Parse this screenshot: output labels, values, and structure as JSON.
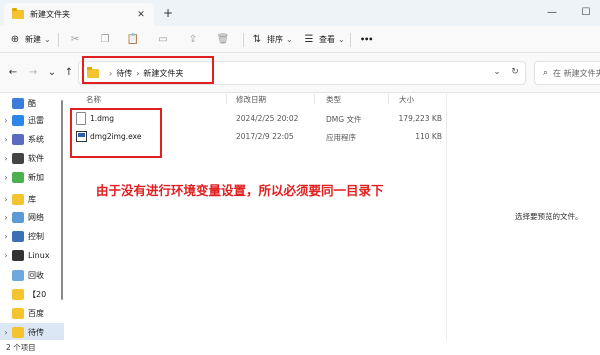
{
  "window": {
    "tab_title": "新建文件夹",
    "tab_close": "✕",
    "new_tab": "+",
    "minimize": "—",
    "maximize": "☐"
  },
  "toolbar": {
    "new_label": "新建",
    "new_chevron": "⌄",
    "sort_label": "排序",
    "sort_chevron": "⌄",
    "view_label": "查看",
    "view_chevron": "⌄",
    "more": "•••"
  },
  "nav": {
    "back": "←",
    "forward": "→",
    "down": "⌄",
    "up": "↑"
  },
  "address": {
    "sep1": "›",
    "crumb1": "待传",
    "sep2": "›",
    "crumb2": "新建文件夹",
    "dropdown": "⌄",
    "refresh": "↻"
  },
  "search": {
    "placeholder": "在 新建文件夹 中搜索"
  },
  "sidebar": {
    "items": [
      {
        "chev": "",
        "label": "酷",
        "icon_color": "#3b7bd9"
      },
      {
        "chev": "›",
        "label": "迅雷",
        "icon_color": "#2b86e8"
      },
      {
        "chev": "›",
        "label": "系统",
        "icon_color": "#5c6bc0"
      },
      {
        "chev": "›",
        "label": "软件",
        "icon_color": "#444444"
      },
      {
        "chev": "›",
        "label": "新加",
        "icon_color": "#4caf50"
      },
      {
        "chev": "›",
        "label": "库",
        "icon_color": "#f4c430"
      },
      {
        "chev": "›",
        "label": "网络",
        "icon_color": "#5b9bd5"
      },
      {
        "chev": "›",
        "label": "控制",
        "icon_color": "#3d6fb5"
      },
      {
        "chev": "›",
        "label": "Linux",
        "icon_color": "#333333"
      },
      {
        "chev": "",
        "label": "回收",
        "icon_color": "#6fa8dc"
      },
      {
        "chev": "",
        "label": "【20",
        "icon_color": "#f4c430"
      },
      {
        "chev": "",
        "label": "百度",
        "icon_color": "#f4c430"
      },
      {
        "chev": "›",
        "label": "待传",
        "icon_color": "#f4c430"
      }
    ]
  },
  "columns": {
    "name": "名称",
    "modified": "修改日期",
    "type": "类型",
    "size": "大小"
  },
  "files": [
    {
      "name": "1.dmg",
      "modified": "2024/2/25 20:02",
      "type": "DMG 文件",
      "size": "179,223 KB"
    },
    {
      "name": "dmg2img.exe",
      "modified": "2017/2/9 22:05",
      "type": "应用程序",
      "size": "110 KB"
    }
  ],
  "annotation": "由于没有进行环境变量设置，所以必须要同一目录下",
  "preview_message": "选择要预览的文件。",
  "status": {
    "count": "2 个项目"
  }
}
